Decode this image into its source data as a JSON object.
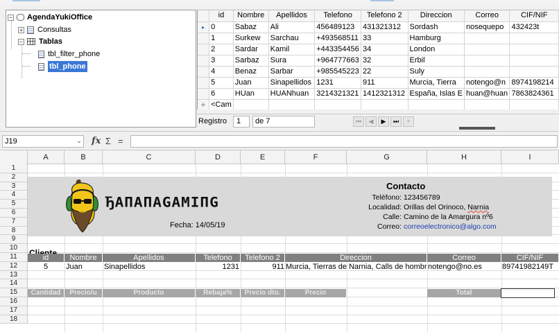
{
  "navigator": {
    "database": "AgendaYukiOffice",
    "queries": "Consultas",
    "tables": "Tablas",
    "table_items": [
      {
        "label": "tbl_filter_phone",
        "selected": false
      },
      {
        "label": "tbl_phone",
        "selected": true
      }
    ],
    "expand_plus": "+",
    "expand_minus": "−"
  },
  "table_view": {
    "columns": [
      "id",
      "Nombre",
      "Apellidos",
      "Telefono",
      "Telefono 2",
      "Direccion",
      "Correo",
      "CIF/NIF"
    ],
    "current_marker": "▸",
    "rows": [
      [
        "0",
        "Sabaz",
        "Ali",
        "456489123",
        "431321312",
        "Sordash",
        "nosequepo",
        "432423t"
      ],
      [
        "1",
        "Surkew",
        "Sarchau",
        "+493568511",
        "33",
        "Hamburg",
        "",
        ""
      ],
      [
        "2",
        "Sardar",
        "Kamil",
        "+443354456",
        "34",
        "London",
        "",
        ""
      ],
      [
        "3",
        "Sarbaz",
        "Sura",
        "+964777663",
        "32",
        "Erbil",
        "",
        ""
      ],
      [
        "4",
        "Benaz",
        "Sarbar",
        "+985545223",
        "22",
        "Suly",
        "",
        ""
      ],
      [
        "5",
        "Juan",
        "Sinapellidos",
        "1231",
        "911",
        "Murcia, Tierra",
        "notengo@n",
        "8974198214"
      ],
      [
        "6",
        "HUan",
        "HUANhuan",
        "3214321321",
        "1412321312",
        "España, Islas E",
        "huan@huan",
        "7863824361"
      ]
    ],
    "new_row_marker": "+",
    "new_row_text": "<Cam"
  },
  "record_bar": {
    "label": "Registro",
    "current": "1",
    "of_text": "de 7",
    "buttons": [
      "⏮",
      "◀",
      "▶",
      "⏭",
      "+"
    ]
  },
  "formula_bar": {
    "name_box": "J19",
    "dropdown": "⌄",
    "fx": "fx",
    "sigma": "Σ",
    "equals": "="
  },
  "sheet": {
    "columns": [
      "A",
      "B",
      "C",
      "D",
      "E",
      "F",
      "G",
      "H",
      "I"
    ],
    "rows": [
      "1",
      "2",
      "3",
      "4",
      "5",
      "6",
      "7",
      "8",
      "9",
      "10",
      "11",
      "12",
      "13",
      "14",
      "15",
      "16",
      "17",
      "18"
    ],
    "brand": "ЂАПАПАGАМIПG",
    "fecha_label": "Fecha:",
    "fecha_value": "14/05/19",
    "contacto": {
      "title": "Contacto",
      "items": [
        {
          "key": "Teléfono:",
          "value": "123456789",
          "type": "plain"
        },
        {
          "key": "Localidad:",
          "value_a": "Orillas del Orinoco, ",
          "value_b": "Narnia",
          "type": "squiggle"
        },
        {
          "key": "Calle:",
          "value": "Camino de la Amargura nº6",
          "type": "plain"
        },
        {
          "key": "Correo:",
          "value": "correoelectronico@algo.com",
          "type": "mail"
        }
      ]
    },
    "cliente_label": "Cliente",
    "cliente_headers": [
      "id",
      "Nombre",
      "Apellidos",
      "Telefono",
      "Telefono 2",
      "Direccion",
      "Correo",
      "CIF/NIF"
    ],
    "cliente_row": {
      "id": "5",
      "nombre": "Juan",
      "apellidos": "Sinapellidos",
      "telefono": "1231",
      "telefono2": "911",
      "direccion": "Murcia, Tierras de Narnia, Calls de hombr",
      "correo": "notengo@no.es",
      "cif": "89741982149T"
    },
    "product_headers": [
      "Cantidad",
      "Precio/u",
      "Producto",
      "Rebaja%",
      "Precio dto.",
      "Precio"
    ],
    "total_label": "Total"
  },
  "colors": {
    "selection": "#3b78d6",
    "header_gray": "#808080",
    "banner_gray": "#d9d9d9",
    "banana_yellow": "#f2c51a",
    "headphone_green": "#2f8f2f"
  }
}
